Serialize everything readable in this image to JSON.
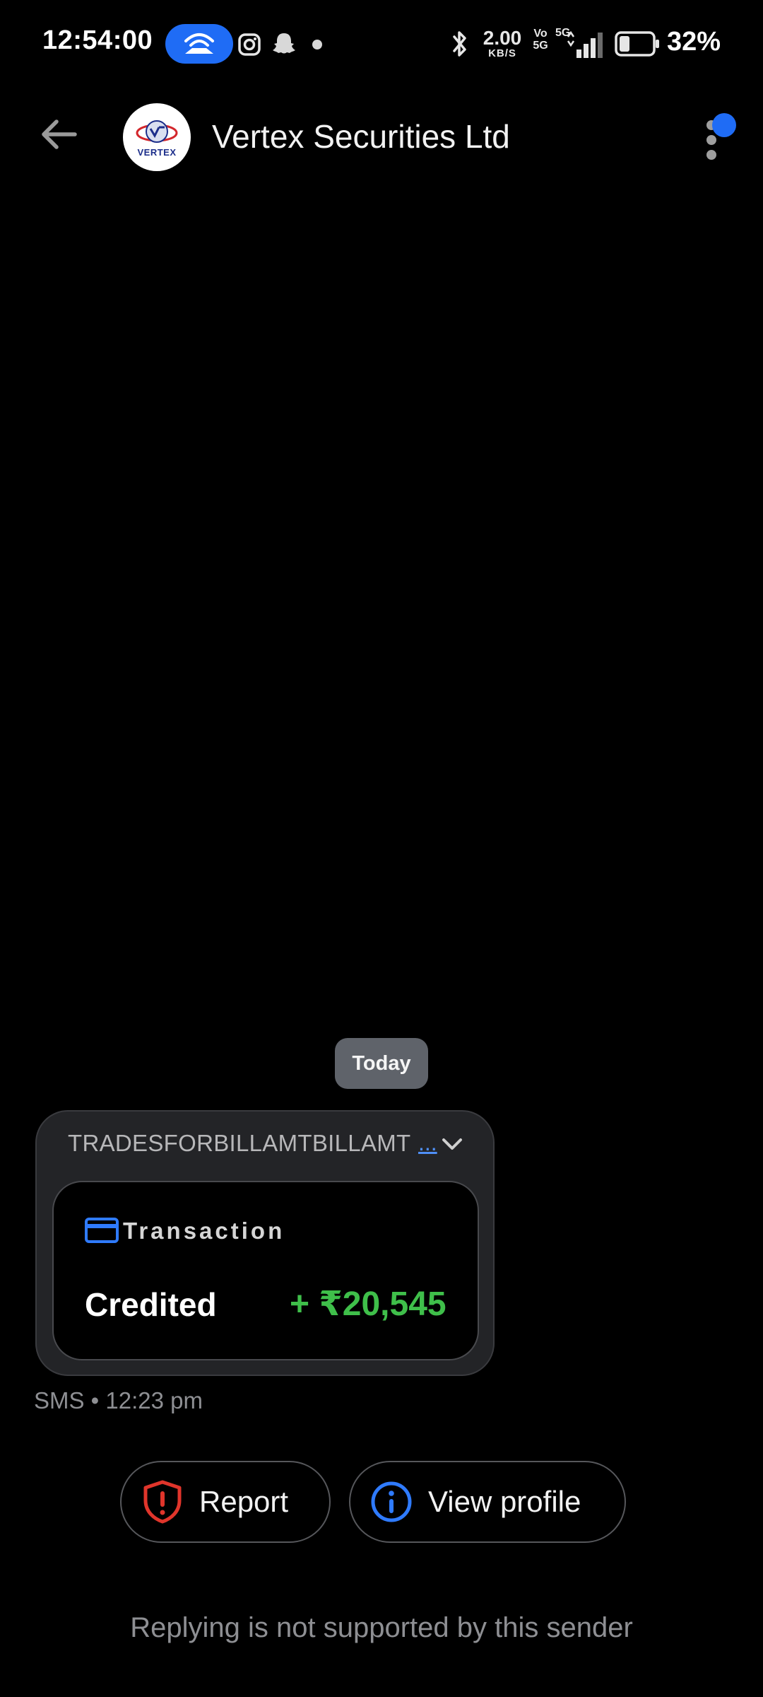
{
  "status_bar": {
    "time": "12:54:00",
    "net_speed_value": "2.00",
    "net_speed_unit": "KB/S",
    "vo_label_top": "Vo",
    "vo_label_bottom": "5G",
    "network_label": "5G",
    "battery_percent": "32%",
    "battery_level": 0.32
  },
  "header": {
    "sender_name": "Vertex Securities Ltd",
    "avatar_text": "VERTEX"
  },
  "conversation": {
    "date_chip": "Today",
    "message": {
      "header_text": "TRADESFORBILLAMTBILLAMT",
      "more_text": "...",
      "card_title": "Transaction",
      "label": "Credited",
      "amount": "+ ₹20,545",
      "meta": "SMS • 12:23 pm"
    }
  },
  "actions": {
    "report_label": "Report",
    "view_profile_label": "View profile"
  },
  "footer": {
    "note": "Replying is not supported by this sender"
  },
  "colors": {
    "accent": "#1f6cf5",
    "credit_green": "#3fbf4a",
    "report_red": "#e0352b",
    "background": "#000000"
  },
  "icons": {
    "back": "arrow-left-icon",
    "menu": "more-vert-icon",
    "card": "credit-card-icon",
    "expand": "chevron-down-icon",
    "report": "shield-alert-icon",
    "profile": "info-icon"
  }
}
